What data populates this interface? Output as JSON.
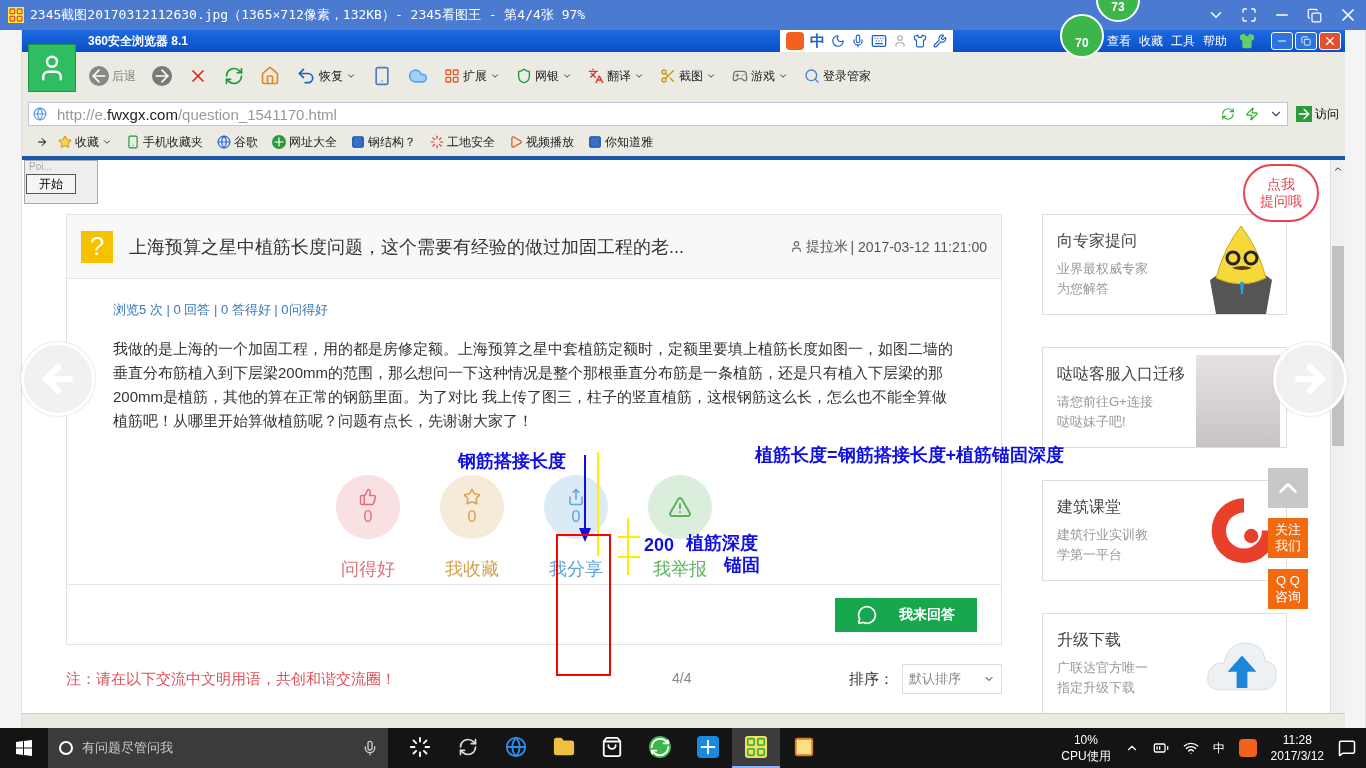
{
  "viewer": {
    "title": "2345截图20170312112630.jpg（1365×712像素，132KB）- 2345看图王 - 第4/4张 97%",
    "badge": "73",
    "page_counter": "4/4"
  },
  "browser": {
    "title": "360安全浏览器 8.1",
    "badge": "70",
    "ime_mode": "中",
    "menu": [
      "查看",
      "收藏",
      "工具",
      "帮助"
    ],
    "toolbar": [
      {
        "kind": "back",
        "label": "后退",
        "disabled": true,
        "dropdown": false
      },
      {
        "kind": "forward",
        "disabled": true,
        "dropdown": false
      },
      {
        "kind": "stop",
        "disabled": false,
        "dropdown": false
      },
      {
        "kind": "refresh",
        "disabled": false,
        "dropdown": false
      },
      {
        "kind": "home",
        "disabled": false,
        "dropdown": false
      },
      {
        "kind": "restore",
        "label": "恢复",
        "disabled": false,
        "dropdown": true
      },
      {
        "kind": "phone",
        "disabled": false,
        "dropdown": false
      },
      {
        "kind": "cloud",
        "disabled": false,
        "dropdown": false
      },
      {
        "kind": "apps",
        "label": "扩展",
        "disabled": false,
        "dropdown": true
      },
      {
        "kind": "shield",
        "label": "网银",
        "disabled": false,
        "dropdown": true
      },
      {
        "kind": "translate",
        "label": "翻译",
        "disabled": false,
        "dropdown": true
      },
      {
        "kind": "scissors",
        "label": "截图",
        "disabled": false,
        "dropdown": true
      },
      {
        "kind": "game",
        "label": "游戏",
        "disabled": false,
        "dropdown": true
      },
      {
        "kind": "key",
        "label": "登录管家",
        "disabled": false,
        "dropdown": false
      }
    ],
    "address": {
      "prefix": "http://e.",
      "domain": "fwxgx.com",
      "path": "/question_1541170.html",
      "go": "访问"
    },
    "bookmarks": [
      {
        "kind": "star",
        "label": "收藏",
        "dropdown": true
      },
      {
        "kind": "phone",
        "label": "手机收藏夹",
        "dropdown": false
      },
      {
        "kind": "google",
        "label": "谷歌",
        "dropdown": false
      },
      {
        "kind": "plus",
        "label": "网址大全",
        "dropdown": false
      },
      {
        "kind": "site",
        "label": "钢结构？",
        "dropdown": false
      },
      {
        "kind": "ring",
        "label": "工地安全",
        "dropdown": false
      },
      {
        "kind": "video",
        "label": "视频播放",
        "dropdown": false
      },
      {
        "kind": "site",
        "label": "你知道雅",
        "dropdown": false
      }
    ],
    "popup": {
      "title": "Poi...",
      "button": "开始"
    }
  },
  "question": {
    "icon": "?",
    "title": "上海预算之星中植筋长度问题，这个需要有经验的做过加固工程的老...",
    "author": "提拉米",
    "date": "| 2017-03-12 11:21:00",
    "stats": "浏览5 次 | 0 回答 | 0 答得好 | 0问得好",
    "body": "我做的是上海的一个加固工程，用的都是房修定额。上海预算之星中套植筋定额时，定额里要填上植筋长度如图一，如图二墙的垂直分布筋植入到下层梁200mm的范围，那么想问一下这种情况是整个那根垂直分布筋是一条植筋，还是只有植入下层梁的那200mm是植筋，其他的算在正常的钢筋里面。为了对比 我上传了图三，柱子的竖直植筋，这根钢筋这么长，怎么也不能全算做植筋吧！从哪里开始算做植筋呢？问题有点长，先谢谢大家了！",
    "actions": [
      {
        "kind": "like",
        "count": "0",
        "label": "问得好",
        "color": "#e0707e"
      },
      {
        "kind": "favorite",
        "count": "0",
        "label": "我收藏",
        "color": "#d4a24c"
      },
      {
        "kind": "share",
        "count": "0",
        "label": "我分享",
        "color": "#5aa6d6"
      },
      {
        "kind": "report",
        "label": "我举报",
        "color": "#5cb25f"
      }
    ],
    "answer_button": "我来回答"
  },
  "notice": "注：请在以下交流中文明用语，共创和谐交流圈！",
  "sort": {
    "label": "排序：",
    "value": "默认排序"
  },
  "sidebar": [
    {
      "kind": "mascot",
      "title": "向专家提问",
      "lines": [
        "业界最权威专家",
        "为您解答"
      ],
      "bubble": [
        "点我",
        "提问哦"
      ]
    },
    {
      "kind": "photo",
      "title": "哒哒客服入口迁移",
      "lines": [
        "请您前往G+连接",
        "哒哒妹子吧!"
      ]
    },
    {
      "kind": "swirl",
      "title": "建筑课堂",
      "lines": [
        "建筑行业实训教",
        "学第一平台"
      ]
    },
    {
      "kind": "upload",
      "title": "升级下载",
      "lines": [
        "广联达官方唯一",
        "指定升级下载"
      ]
    }
  ],
  "float": {
    "follow": [
      "关注",
      "我们"
    ],
    "qq": [
      "Q Q",
      "咨询"
    ]
  },
  "annotations": {
    "lap": "钢筋搭接长度",
    "formula": "植筋长度=钢筋搭接长度+植筋锚固深度",
    "dimension": "200",
    "depth": "植筋深度",
    "anchor": "锚固"
  },
  "taskbar": {
    "search": "有问题尽管问我",
    "apps": [
      {
        "kind": "fan",
        "selected": false
      },
      {
        "kind": "swirl",
        "selected": false
      },
      {
        "kind": "edge",
        "selected": false
      },
      {
        "kind": "folder",
        "selected": false
      },
      {
        "kind": "store",
        "selected": false
      },
      {
        "kind": "browser",
        "selected": false
      },
      {
        "kind": "tool",
        "selected": false
      },
      {
        "kind": "viewer",
        "selected": true
      },
      {
        "kind": "notes",
        "selected": false
      }
    ],
    "cpu": "10%",
    "cpu_label": "CPU使用",
    "ime": "中",
    "time": "11:28",
    "date": "2017/3/12"
  }
}
